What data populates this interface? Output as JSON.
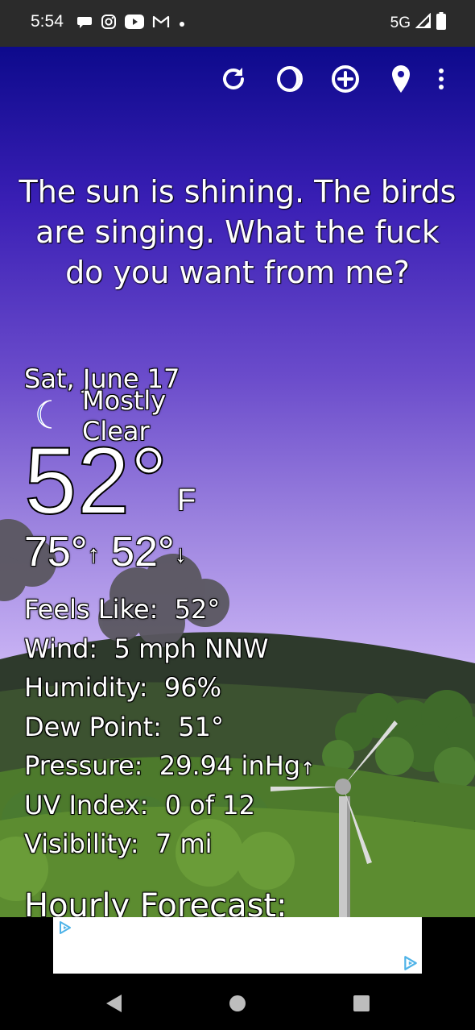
{
  "status_bar": {
    "time": "5:54",
    "network": "5G"
  },
  "toolbar": {
    "icons": [
      "refresh-icon",
      "theme-icon",
      "add-location-icon",
      "location-pin-icon",
      "more-vert-icon"
    ]
  },
  "quote": {
    "text": "The sun is shining. The birds are singing. What the fuck do you want from me?"
  },
  "weather": {
    "date": "Sat, June 17",
    "condition": "Mostly Clear",
    "temperature": "52°",
    "unit": "F",
    "high": "75°",
    "low": "52°",
    "details": [
      {
        "label": "Feels Like:",
        "value": "52°"
      },
      {
        "label": "Wind:",
        "value": "5 mph NNW"
      },
      {
        "label": "Humidity:",
        "value": "96%"
      },
      {
        "label": "Dew Point:",
        "value": "51°"
      },
      {
        "label": "Pressure:",
        "value": "29.94 inHg"
      },
      {
        "label": "UV Index:",
        "value": "0 of 12"
      },
      {
        "label": "Visibility:",
        "value": "7 mi"
      }
    ]
  },
  "hourly": {
    "title": "Hourly Forecast:"
  },
  "colors": {
    "sky_top": "#0d0a8c",
    "sky_bottom": "#d8c5ff",
    "status_bar": "#2b2b2b",
    "ad_icon": "#4fb3e8"
  }
}
